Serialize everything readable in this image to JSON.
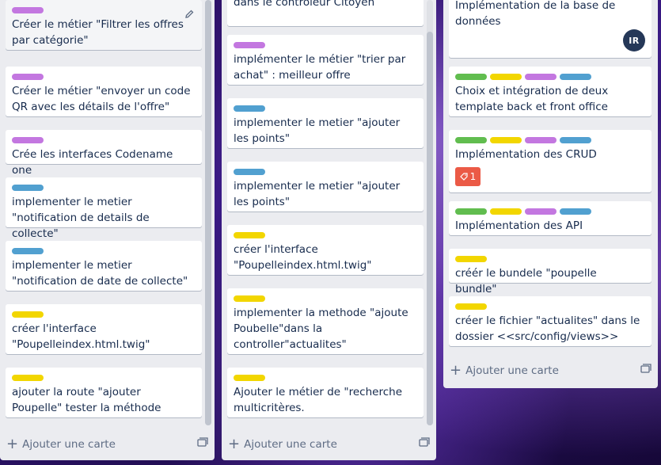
{
  "colors": {
    "purple": "#c377e0",
    "blue": "#51a0d0",
    "yellow": "#f2d600",
    "green": "#61bd4f",
    "red": "#eb5a46"
  },
  "lists": [
    {
      "cards": [
        {
          "labels": [
            "purple"
          ],
          "title": "Créer le métier \"Filtrer les offres par catégorie\""
        },
        {
          "labels": [
            "purple"
          ],
          "title": "Créer le métier \"envoyer un code QR avec les détails de l'offre\""
        },
        {
          "labels": [
            "purple"
          ],
          "title": "Crée les interfaces Codename one"
        },
        {
          "labels": [
            "blue"
          ],
          "title": "implementer le metier \"notification de details de collecte\""
        },
        {
          "labels": [
            "blue"
          ],
          "title": "implementer le metier \"notification de date de collecte\""
        },
        {
          "labels": [
            "yellow"
          ],
          "title": "créer l'interface \"Poupelleindex.html.twig\""
        },
        {
          "labels": [
            "yellow"
          ],
          "title": "ajouter la route \"ajouter Poupelle\" tester la méthode"
        }
      ],
      "add_card_label": "Ajouter une carte"
    },
    {
      "cards": [
        {
          "labels": [],
          "title": "implementer la methode afficher dans le contrôleur Citoyen"
        },
        {
          "labels": [
            "purple"
          ],
          "title": "implémenter le métier \"trier par achat\" : meilleur offre"
        },
        {
          "labels": [
            "blue"
          ],
          "title": "implementer le metier \"ajouter les points\""
        },
        {
          "labels": [
            "blue"
          ],
          "title": "implementer le metier \"ajouter les points\""
        },
        {
          "labels": [
            "yellow"
          ],
          "title": "créer l'interface \"Poupelleindex.html.twig\""
        },
        {
          "labels": [
            "yellow"
          ],
          "title": "implementer la methode \"ajoute Poubelle\"dans la controller\"actualites\""
        },
        {
          "labels": [
            "yellow"
          ],
          "title": "Ajouter le métier de \"recherche multicritères."
        }
      ],
      "add_card_label": "Ajouter une carte"
    },
    {
      "cards": [
        {
          "labels": [],
          "title": "Implémentation de la base de données",
          "avatar": "IR"
        },
        {
          "labels": [
            "green",
            "yellow",
            "purple",
            "blue"
          ],
          "title": "Choix et intégration de deux template back et front office"
        },
        {
          "labels": [
            "green",
            "yellow",
            "purple",
            "blue"
          ],
          "title": "Implémentation des CRUD",
          "badge": "1"
        },
        {
          "labels": [
            "green",
            "yellow",
            "purple",
            "blue"
          ],
          "title": "Implémentation des API"
        },
        {
          "labels": [
            "yellow"
          ],
          "title": "créér le bundele \"poupelle bundle\""
        },
        {
          "labels": [
            "yellow"
          ],
          "title": "créer le fichier \"actualites\" dans le dossier <<src/config/views>>"
        }
      ],
      "add_card_label": "Ajouter une carte"
    }
  ]
}
